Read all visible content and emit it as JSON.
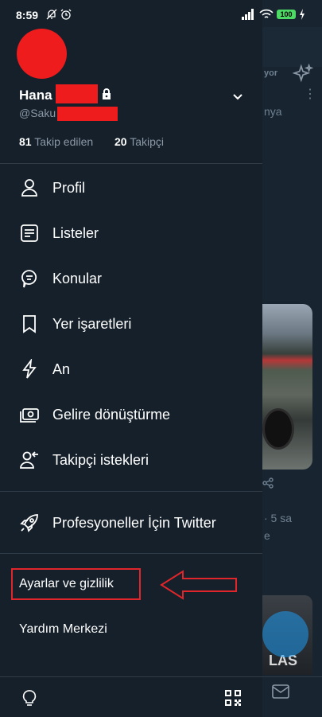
{
  "status_bar": {
    "time": "8:59",
    "battery": "100"
  },
  "background": {
    "text_1": "yor",
    "text_2": "nya",
    "text_3": "· 5 sa",
    "text_4": "e",
    "photo2_text": "LAS"
  },
  "profile": {
    "name": "Hana",
    "handle": "@Saku",
    "following_count": "81",
    "following_label": "Takip edilen",
    "followers_count": "20",
    "followers_label": "Takipçi"
  },
  "menu": [
    {
      "label": "Profil",
      "icon": "person-icon"
    },
    {
      "label": "Listeler",
      "icon": "list-icon"
    },
    {
      "label": "Konular",
      "icon": "topics-icon"
    },
    {
      "label": "Yer işaretleri",
      "icon": "bookmark-icon"
    },
    {
      "label": "An",
      "icon": "lightning-icon"
    },
    {
      "label": "Gelire dönüştürme",
      "icon": "money-icon"
    },
    {
      "label": "Takipçi istekleri",
      "icon": "follow-request-icon"
    }
  ],
  "professional": {
    "label": "Profesyoneller İçin Twitter",
    "icon": "rocket-icon"
  },
  "settings": {
    "settings_privacy": "Ayarlar ve gizlilik",
    "help_center": "Yardım Merkezi"
  },
  "colors": {
    "background": "#15202b",
    "text_secondary": "#8b98a5",
    "divider": "#2f3b47",
    "annotation": "#e0262a",
    "redaction": "#ee1c1c",
    "accent": "#1d9bf0"
  }
}
